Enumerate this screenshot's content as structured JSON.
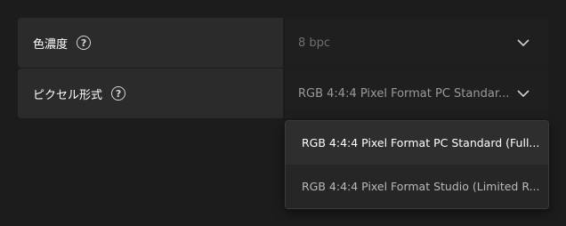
{
  "settings": [
    {
      "label": "色濃度",
      "value": "8 bpc",
      "help_icon": "question-circle-icon",
      "chevron_icon": "chevron-down-icon"
    },
    {
      "label": "ピクセル形式",
      "value": "RGB 4:4:4 Pixel Format PC Standar...",
      "help_icon": "question-circle-icon",
      "chevron_icon": "chevron-down-icon"
    }
  ],
  "dropdown": {
    "options": [
      "RGB 4:4:4 Pixel Format PC Standard (Full...",
      "RGB 4:4:4 Pixel Format Studio (Limited R..."
    ]
  },
  "colors": {
    "background": "#1c1c1c",
    "label_cell": "#2b2b2b",
    "value_cell": "#1f1f1f",
    "dropdown_bg": "#2b2b2b"
  },
  "help_glyph": "?"
}
